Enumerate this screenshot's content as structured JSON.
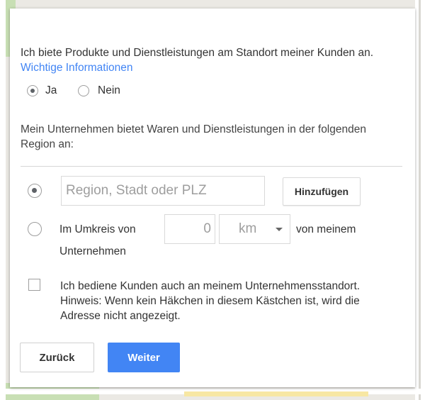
{
  "intro": {
    "text": "Ich biete Produkte und Dienstleistungen am Standort meiner Kunden an.",
    "link": "Wichtige Informationen"
  },
  "options": {
    "yes_label": "Ja",
    "no_label": "Nein",
    "selected": "Ja"
  },
  "region_description": "Mein Unternehmen bietet Waren und Dienstleistungen in der folgenden Region an:",
  "region_field": {
    "placeholder": "Region, Stadt oder PLZ",
    "value": "",
    "add_button": "Hinzufügen"
  },
  "radius": {
    "prefix": "Im Umkreis von",
    "value": "0",
    "unit": "km",
    "suffix_1": "von meinem",
    "suffix_2": "Unternehmen"
  },
  "checkbox": {
    "text": "Ich bediene Kunden auch an meinem Unternehmensstandort. Hinweis: Wenn kein Häkchen in diesem Kästchen ist, wird die Adresse nicht angezeigt.",
    "checked": false
  },
  "buttons": {
    "back": "Zurück",
    "next": "Weiter"
  },
  "colors": {
    "accent": "#4285f4",
    "link": "#4285f4"
  }
}
